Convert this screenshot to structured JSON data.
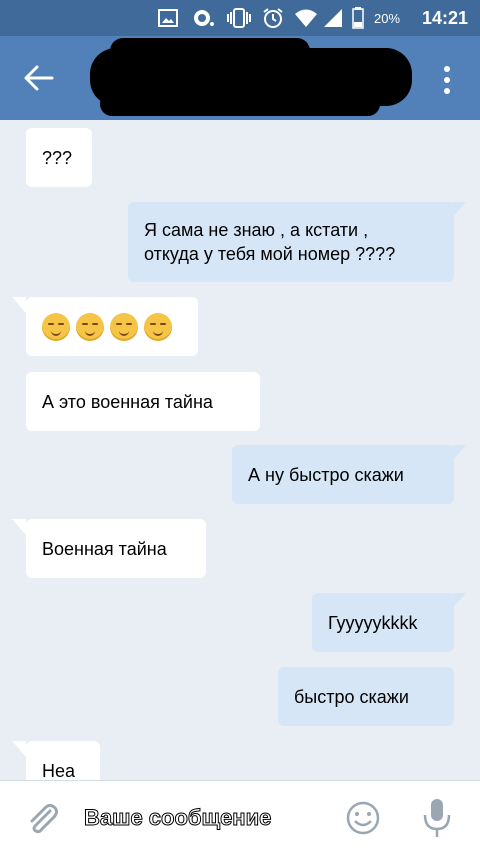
{
  "status_bar": {
    "battery_percent": "20%",
    "time": "14:21"
  },
  "app_bar": {
    "back_icon": "arrow-left-icon",
    "menu_icon": "more-vertical-icon"
  },
  "messages": [
    {
      "direction": "incoming",
      "text": "???"
    },
    {
      "direction": "outgoing",
      "text_line1": "Я сама не знаю , а кстати ,",
      "text_line2": "откуда у тебя мой номер ????"
    },
    {
      "direction": "incoming",
      "emoji": [
        "smirk",
        "smirk",
        "smirk",
        "smirk"
      ]
    },
    {
      "direction": "incoming",
      "text": "А это военная тайна"
    },
    {
      "direction": "outgoing",
      "text": "А ну быстро скажи"
    },
    {
      "direction": "incoming",
      "text": "Военная тайна"
    },
    {
      "direction": "outgoing",
      "text": "Гуууууkkkk"
    },
    {
      "direction": "outgoing",
      "text": "быстро скажи"
    },
    {
      "direction": "incoming",
      "text": "Неа"
    }
  ],
  "input": {
    "placeholder": "Ваше сообщение",
    "attach_icon": "paperclip-icon",
    "emoji_icon": "smile-icon",
    "mic_icon": "microphone-icon"
  }
}
